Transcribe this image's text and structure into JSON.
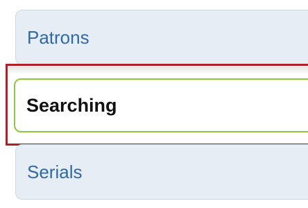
{
  "nav": {
    "items": [
      {
        "label": "Patrons"
      },
      {
        "label": "Searching"
      },
      {
        "label": "Serials"
      }
    ]
  },
  "colors": {
    "link": "#2f6aa6",
    "tab_bg": "#e7edf4",
    "active_border": "#8dc63f",
    "highlight": "#b1202a"
  }
}
